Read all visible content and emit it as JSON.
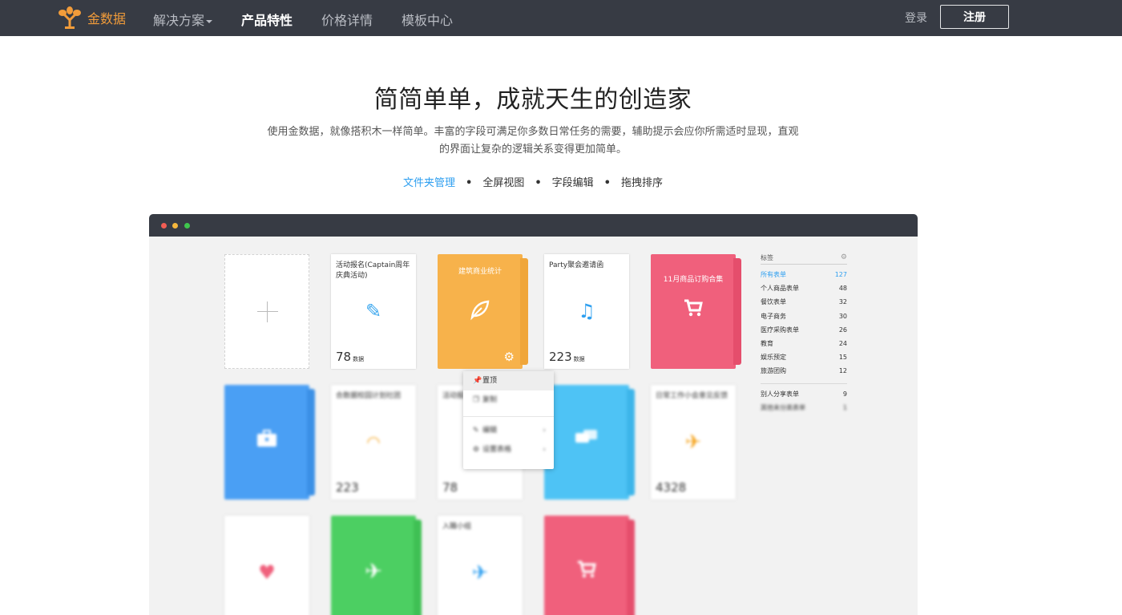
{
  "nav": {
    "brand": "金数据",
    "links": [
      "解决方案",
      "产品特性",
      "价格详情",
      "模板中心"
    ],
    "login": "登录",
    "register": "注册"
  },
  "hero": {
    "title": "简简单单，成就天生的创造家",
    "desc_line1": "使用金数据，就像搭积木一样简单。丰富的字段可满足你多数日常任务的需要，辅助提示会应你所需适时显现，直观",
    "desc_line2": "的界面让复杂的逻辑关系变得更加简单。",
    "tabs": [
      "文件夹管理",
      "全屏视图",
      "字段编辑",
      "拖拽排序"
    ]
  },
  "colors": {
    "nav_bg": "#373b44",
    "brand_orange": "#f29c3a",
    "accent_blue": "#2e9ff0",
    "folder_orange": "#f7b24b",
    "folder_pink": "#f0607c",
    "folder_blue": "#4a9ff4",
    "folder_cyan": "#4ec3f5",
    "folder_green": "#4ccf62"
  },
  "cards": {
    "c1": {
      "title": "活动报名(Captain周年庆典活动)",
      "icon": "pencil-icon",
      "count": "78",
      "unit": "数据"
    },
    "c2": {
      "title": "建筑商业统计",
      "icon": "leaf-icon"
    },
    "c3": {
      "title": "Party聚会邀请函",
      "icon": "music-note-icon",
      "count": "223",
      "unit": "数据"
    },
    "c4": {
      "title": "11月商品订购合集",
      "icon": "cart-icon"
    },
    "c5": {
      "title": "合数据校园计划社团",
      "icon": "gauge-icon",
      "count": "223"
    },
    "c6": {
      "title": "活动报名",
      "count": "78"
    },
    "c7": {
      "title": "日常工作小会意见反馈",
      "icon": "plane-icon",
      "count": "4328"
    },
    "c8": {
      "icon": "heart-icon"
    },
    "c9": {
      "title": "入職小组",
      "icon": "plane-icon"
    }
  },
  "menu": {
    "items": [
      "置顶",
      "复制",
      "编辑",
      "设置表格"
    ]
  },
  "sidebar": {
    "header": "标签",
    "items": [
      {
        "label": "所有表单",
        "count": "127"
      },
      {
        "label": "个人商品表单",
        "count": "48"
      },
      {
        "label": "餐饮表单",
        "count": "32"
      },
      {
        "label": "电子商务",
        "count": "30"
      },
      {
        "label": "医疗采购表单",
        "count": "26"
      },
      {
        "label": "教育",
        "count": "24"
      },
      {
        "label": "娱乐预定",
        "count": "15"
      },
      {
        "label": "旅游团购",
        "count": "12"
      }
    ],
    "shared": {
      "label": "别人分享表单",
      "count": "9"
    },
    "other": {
      "label": "其他未分类表单",
      "count": "1"
    }
  }
}
